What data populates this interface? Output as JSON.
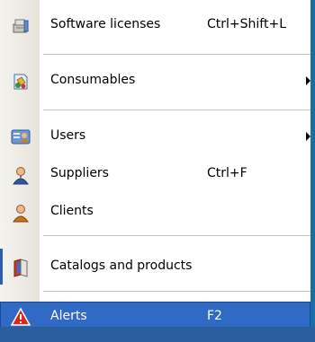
{
  "menu": {
    "items": [
      {
        "label": "Software licenses",
        "shortcut": "Ctrl+Shift+L",
        "icon": "software-licenses-icon"
      },
      {
        "label": "Consumables",
        "shortcut": "",
        "icon": "consumables-icon",
        "submenu": true
      },
      {
        "label": "Users",
        "shortcut": "",
        "icon": "users-icon",
        "submenu": true
      },
      {
        "label": "Suppliers",
        "shortcut": "Ctrl+F",
        "icon": "suppliers-icon"
      },
      {
        "label": "Clients",
        "shortcut": "",
        "icon": "clients-icon"
      },
      {
        "label": "Catalogs and products",
        "shortcut": "",
        "icon": "catalogs-icon"
      },
      {
        "label": "Alerts",
        "shortcut": "F2",
        "icon": "alerts-icon",
        "highlighted": true
      }
    ]
  },
  "colors": {
    "highlight": "#316ac5",
    "accent": "#1a6ea8"
  }
}
